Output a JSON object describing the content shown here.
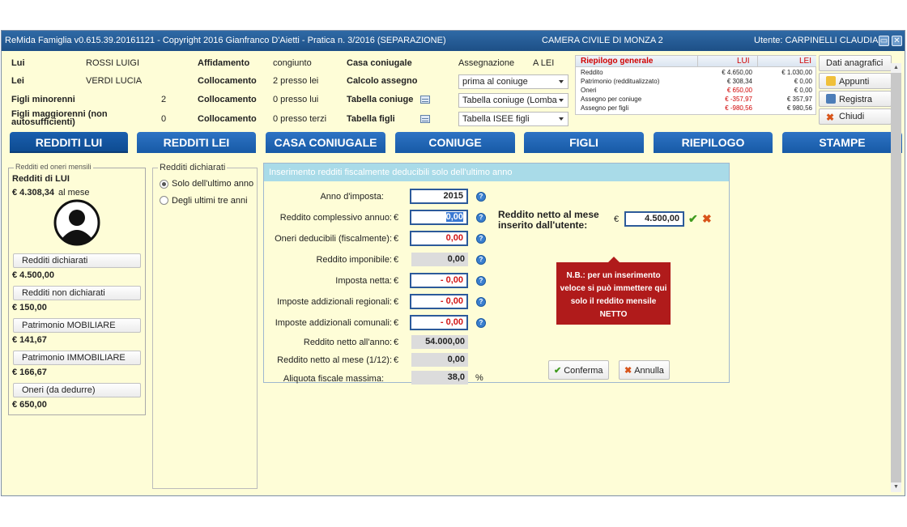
{
  "titlebar": {
    "left": "ReMida Famiglia v0.615.39.20161121 - Copyright 2016 Gianfranco D'Aietti - Pratica n. 3/2016 (SEPARAZIONE)",
    "center": "CAMERA CIVILE DI MONZA 2",
    "user": "Utente: CARPINELLI CLAUDIA"
  },
  "header": {
    "lui_label": "Lui",
    "lui_value": "ROSSI LUIGI",
    "lei_label": "Lei",
    "lei_value": "VERDI LUCIA",
    "figli_min_label": "Figli minorenni",
    "figli_min_value": "2",
    "figli_mag_label": "Figli maggiorenni (non autosufficienti)",
    "figli_mag_value": "0",
    "affidamento_label": "Affidamento",
    "affidamento_value": "congiunto",
    "collocamento_label": "Collocamento",
    "collocamento_1": "2 presso lei",
    "collocamento_2": "0 presso lui",
    "collocamento_3": "0 presso terzi",
    "casa_label": "Casa coniugale",
    "assegnazione_label": "Assegnazione",
    "assegnazione_value": "A LEI",
    "calcolo_label": "Calcolo assegno",
    "calcolo_value": "prima al coniuge",
    "tabella_coniuge_label": "Tabella coniuge",
    "tabella_coniuge_value": "Tabella coniuge (Lomba",
    "tabella_figli_label": "Tabella figli",
    "tabella_figli_value": "Tabella ISEE figli"
  },
  "summary": {
    "title": "Riepilogo generale",
    "col_lui": "LUI",
    "col_lei": "LEI",
    "rows": [
      {
        "label": "Reddito",
        "lui": "€ 4.650,00",
        "lei": "€ 1.030,00",
        "lui_red": false
      },
      {
        "label": "Patrimonio (redditualizzato)",
        "lui": "€ 308,34",
        "lei": "€ 0,00",
        "lui_red": false
      },
      {
        "label": "Oneri",
        "lui": "€ 650,00",
        "lei": "€ 0,00",
        "lui_red": true
      },
      {
        "label": "Assegno per coniuge",
        "lui": "€ -357,97",
        "lei": "€ 357,97",
        "lui_red": true
      },
      {
        "label": "Assegno per figli",
        "lui": "€ -980,56",
        "lei": "€ 980,56",
        "lui_red": true
      }
    ]
  },
  "side_buttons": {
    "anagrafici": "Dati anagrafici",
    "appunti": "Appunti",
    "registra": "Registra",
    "chiudi": "Chiudi"
  },
  "tabs": [
    "REDDITI LUI",
    "REDDITI LEI",
    "CASA CONIUGALE",
    "CONIUGE",
    "FIGLI",
    "RIEPILOGO",
    "STAMPE"
  ],
  "left_panel": {
    "group_title": "Redditi ed oneri mensili",
    "title": "Redditi di LUI",
    "monthly": "€ 4.308,34",
    "monthly_suffix": "al mese",
    "items": [
      {
        "label": "Redditi dichiarati",
        "value": "€ 4.500,00"
      },
      {
        "label": "Redditi non dichiarati",
        "value": "€ 150,00"
      },
      {
        "label": "Patrimonio MOBILIARE",
        "value": "€ 141,67"
      },
      {
        "label": "Patrimonio IMMOBILIARE",
        "value": "€ 166,67"
      },
      {
        "label": "Oneri (da dedurre)",
        "value": "€ 650,00"
      }
    ]
  },
  "radio_group": {
    "title": "Redditi dichiarati",
    "opt1": "Solo dell'ultimo anno",
    "opt2": "Degli ultimi tre anni",
    "selected": "opt1"
  },
  "form": {
    "header": "Inserimento redditi fiscalmente deducibili solo dell'ultimo anno",
    "anno_label": "Anno d'imposta:",
    "anno": "2015",
    "complessivo_label": "Reddito complessivo annuo:",
    "complessivo": "0,00",
    "oneri_label": "Oneri deducibili (fiscalmente):",
    "oneri": "0,00",
    "imponibile_label": "Reddito imponibile:",
    "imponibile": "0,00",
    "imposta_label": "Imposta netta:",
    "imposta": "- 0,00",
    "regionali_label": "Imposte addizionali regionali:",
    "regionali": "- 0,00",
    "comunali_label": "Imposte addizionali comunali:",
    "comunali": "- 0,00",
    "netto_anno_label": "Reddito netto all'anno:",
    "netto_anno": "54.000,00",
    "netto_mese_label": "Reddito netto al mese (1/12):",
    "netto_mese": "0,00",
    "aliquota_label": "Aliquota fiscale massima:",
    "aliquota": "38,0",
    "euro": "€",
    "percent": "%",
    "utente_label_1": "Reddito netto al mese",
    "utente_label_2": "inserito dall'utente:",
    "utente_value": "4.500,00",
    "note": "N.B.: per un inserimento veloce si può immettere qui solo il reddito mensile NETTO",
    "confirm": "Conferma",
    "cancel": "Annulla"
  }
}
